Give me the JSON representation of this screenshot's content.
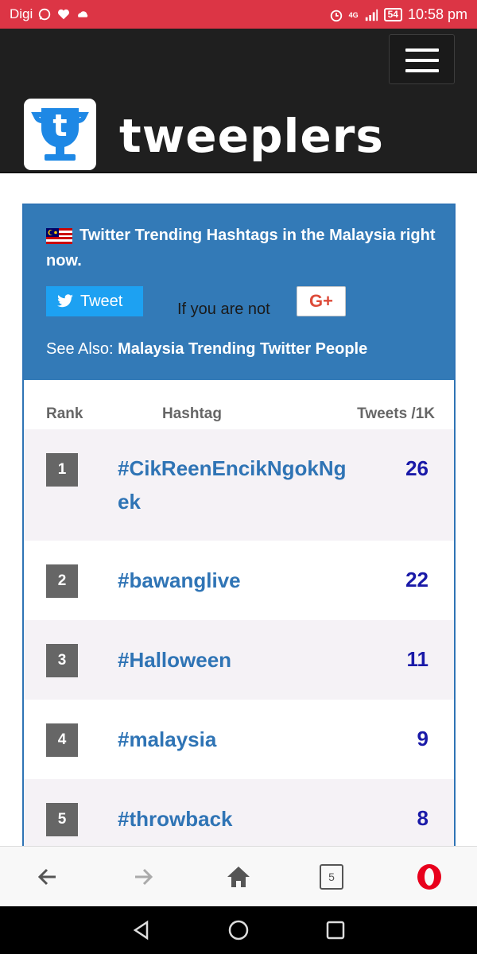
{
  "status_bar": {
    "carrier": "Digi",
    "network": "4G",
    "battery": "54",
    "time": "10:58 pm",
    "icons": [
      "whatsapp-icon",
      "heart-icon",
      "cloud-icon",
      "alarm-icon",
      "signal-icon",
      "battery-icon"
    ]
  },
  "header": {
    "brand": "tweeplers",
    "logo_letter": "t",
    "menu_icon": "hamburger-icon",
    "brand_color": "#1f1f1f"
  },
  "panel": {
    "title": "Twitter Trending Hashtags in the Malaysia right now.",
    "tweet_label": "Tweet",
    "not_you_text": "If you are not",
    "gplus_label": "G+",
    "see_also_label": "See Also:",
    "see_also_link": "Malaysia Trending Twitter People",
    "accent_color": "#337ab7"
  },
  "table": {
    "headers": {
      "rank": "Rank",
      "hashtag": "Hashtag",
      "tweets": "Tweets /1K"
    },
    "rows": [
      {
        "rank": "1",
        "hashtag": "#CikReenEncikNgokNgek",
        "tweets": "26"
      },
      {
        "rank": "2",
        "hashtag": "#bawanglive",
        "tweets": "22"
      },
      {
        "rank": "3",
        "hashtag": "#Halloween",
        "tweets": "11"
      },
      {
        "rank": "4",
        "hashtag": "#malaysia",
        "tweets": "9"
      },
      {
        "rank": "5",
        "hashtag": "#throwback",
        "tweets": "8"
      }
    ]
  },
  "browser_bar": {
    "tabs_count": "5",
    "icons": [
      "back-arrow-icon",
      "forward-arrow-icon",
      "home-icon",
      "tabs-icon",
      "opera-icon"
    ]
  },
  "nav_bar": {
    "icons": [
      "nav-back-icon",
      "nav-home-icon",
      "nav-recents-icon"
    ]
  }
}
